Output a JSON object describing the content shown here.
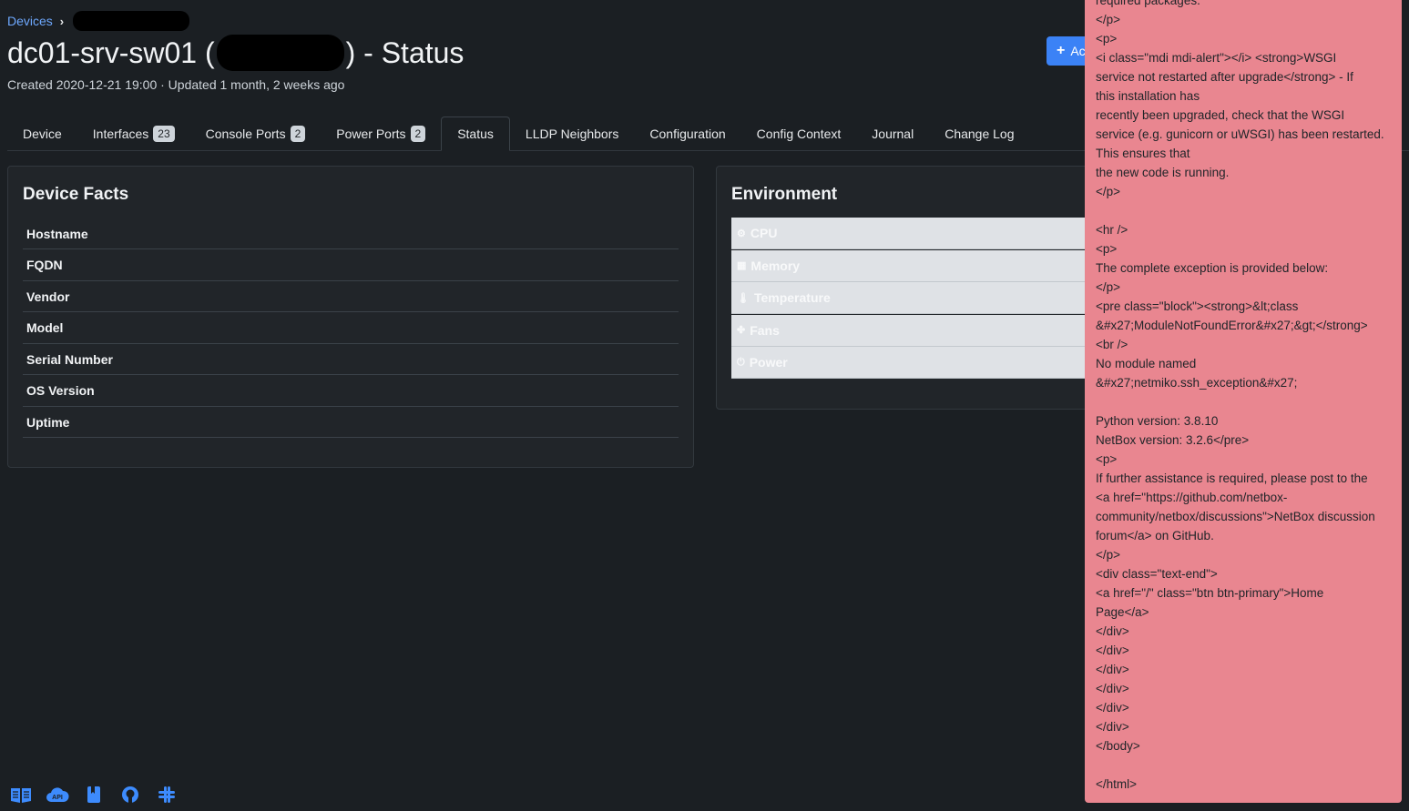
{
  "breadcrumb": {
    "root": "Devices",
    "sep": "›"
  },
  "header": {
    "name": "dc01-srv-sw01 (",
    "suffix": ") - Status",
    "meta": "Created 2020-12-21 19:00 · Updated 1 month, 2 weeks ago",
    "add_button": "Ac"
  },
  "tabs": [
    {
      "label": "Device"
    },
    {
      "label": "Interfaces",
      "badge": "23"
    },
    {
      "label": "Console Ports",
      "badge": "2"
    },
    {
      "label": "Power Ports",
      "badge": "2"
    },
    {
      "label": "Status",
      "active": true
    },
    {
      "label": "LLDP Neighbors"
    },
    {
      "label": "Configuration"
    },
    {
      "label": "Config Context"
    },
    {
      "label": "Journal"
    },
    {
      "label": "Change Log"
    }
  ],
  "facts": {
    "title": "Device Facts",
    "rows": [
      "Hostname",
      "FQDN",
      "Vendor",
      "Model",
      "Serial Number",
      "OS Version",
      "Uptime"
    ]
  },
  "environment": {
    "title": "Environment",
    "rows": [
      {
        "label": "CPU",
        "icon": "cpu-icon",
        "glyph": "⚙"
      },
      {
        "label": "Memory",
        "icon": "memory-icon",
        "glyph": "▦"
      },
      {
        "label": "Temperature",
        "icon": "thermometer-icon",
        "glyph": "🌡"
      },
      {
        "label": "Fans",
        "icon": "fan-icon",
        "glyph": "✤"
      },
      {
        "label": "Power",
        "icon": "power-icon",
        "glyph": "⏻"
      }
    ]
  },
  "error_lines": [
    "required packages.",
    "</p>",
    "<p>",
    "<i class=\"mdi mdi-alert\"></i> <strong>WSGI",
    "service not restarted after upgrade</strong> - If",
    "this installation has",
    "recently been upgraded, check that the WSGI",
    "service (e.g. gunicorn or uWSGI) has been restarted.",
    "This ensures that",
    "the new code is running.",
    "</p>",
    "",
    "<hr />",
    "<p>",
    "The complete exception is provided below:",
    "</p>",
    "<pre class=\"block\"><strong>&lt;class",
    "&#x27;ModuleNotFoundError&#x27;&gt;</strong>",
    "<br />",
    "No module named",
    "&#x27;netmiko.ssh_exception&#x27;",
    "",
    "Python version: 3.8.10",
    "NetBox version: 3.2.6</pre>",
    "<p>",
    "If further assistance is required, please post to the",
    "<a href=\"https://github.com/netbox-",
    "community/netbox/discussions\">NetBox discussion",
    "forum</a> on GitHub.",
    "</p>",
    "<div class=\"text-end\">",
    "<a href=\"/\" class=\"btn btn-primary\">Home",
    "Page</a>",
    "</div>",
    "</div>",
    "</div>",
    "</div>",
    "</div>",
    "</div>",
    "</body>",
    "",
    "</html>"
  ],
  "footer_icons": [
    "docs-icon",
    "cloud-api-icon",
    "book-icon",
    "github-icon",
    "slack-icon"
  ]
}
